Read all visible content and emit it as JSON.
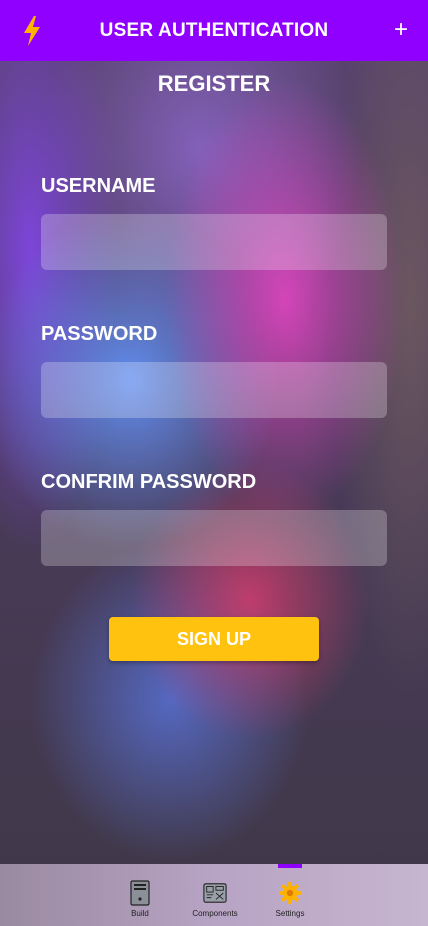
{
  "header": {
    "title": "USER AUTHENTICATION",
    "left_icon": "lightning-bolt-icon",
    "right_icon": "+"
  },
  "form": {
    "heading": "REGISTER",
    "username_label": "USERNAME",
    "username_value": "",
    "password_label": "PASSWORD",
    "password_value": "",
    "confirm_label": "CONFRIM PASSWORD",
    "confirm_value": "",
    "submit_label": "SIGN UP"
  },
  "bottom_nav": {
    "items": [
      {
        "label": "Build",
        "icon": "build-icon"
      },
      {
        "label": "Components",
        "icon": "components-icon"
      },
      {
        "label": "Settings",
        "icon": "gear-icon",
        "active": true
      }
    ]
  },
  "colors": {
    "accent": "#8f00ff",
    "button": "#ffc20e",
    "icon_yellow": "#ffb300"
  }
}
